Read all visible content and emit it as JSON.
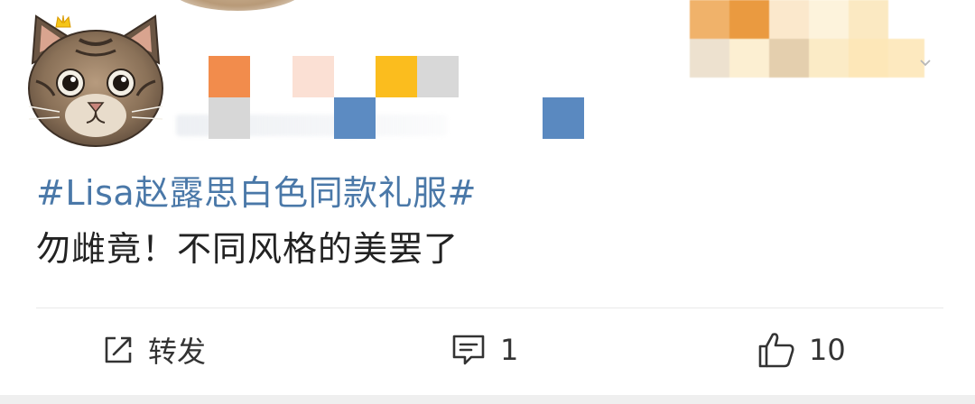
{
  "post": {
    "topic": "#Lisa赵露思白色同款礼服#",
    "body": "勿雌竟！不同风格的美罢了"
  },
  "actions": {
    "repost_label": "转发",
    "comment_count": "1",
    "like_count": "10"
  },
  "icons": {
    "repost": "share-square-icon",
    "comment": "comment-bubble-icon",
    "like": "thumbs-up-icon",
    "more": "chevron-down-icon"
  },
  "colors": {
    "topic_link": "#4a78a8",
    "body_text": "#222222",
    "action_text": "#333333",
    "divider": "#e9e9e9"
  }
}
